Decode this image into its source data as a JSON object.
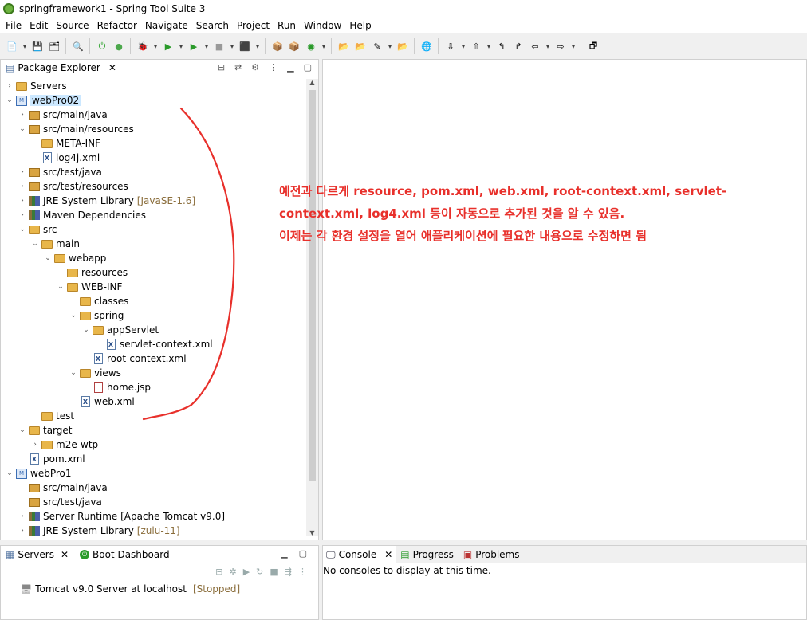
{
  "window": {
    "title": "springframework1 - Spring Tool Suite 3"
  },
  "menu": [
    "File",
    "Edit",
    "Source",
    "Refactor",
    "Navigate",
    "Search",
    "Project",
    "Run",
    "Window",
    "Help"
  ],
  "package_explorer": {
    "tab": "Package Explorer",
    "items": [
      {
        "label": "Servers",
        "kind": "folder",
        "depth": 0,
        "twisty": "›"
      },
      {
        "label": "webPro02",
        "kind": "project",
        "depth": 0,
        "twisty": "⌄",
        "selected": true
      },
      {
        "label": "src/main/java",
        "kind": "pkg",
        "depth": 1,
        "twisty": "›"
      },
      {
        "label": "src/main/resources",
        "kind": "pkg",
        "depth": 1,
        "twisty": "⌄"
      },
      {
        "label": "META-INF",
        "kind": "folder",
        "depth": 2,
        "twisty": ""
      },
      {
        "label": "log4j.xml",
        "kind": "xml",
        "depth": 2,
        "twisty": ""
      },
      {
        "label": "src/test/java",
        "kind": "pkg",
        "depth": 1,
        "twisty": "›"
      },
      {
        "label": "src/test/resources",
        "kind": "pkg",
        "depth": 1,
        "twisty": "›"
      },
      {
        "label": "JRE System Library",
        "suffix": "[JavaSE-1.6]",
        "kind": "lib",
        "depth": 1,
        "twisty": "›"
      },
      {
        "label": "Maven Dependencies",
        "kind": "lib",
        "depth": 1,
        "twisty": "›"
      },
      {
        "label": "src",
        "kind": "folder",
        "depth": 1,
        "twisty": "⌄"
      },
      {
        "label": "main",
        "kind": "folder",
        "depth": 2,
        "twisty": "⌄"
      },
      {
        "label": "webapp",
        "kind": "folder",
        "depth": 3,
        "twisty": "⌄"
      },
      {
        "label": "resources",
        "kind": "folder",
        "depth": 4,
        "twisty": ""
      },
      {
        "label": "WEB-INF",
        "kind": "folder",
        "depth": 4,
        "twisty": "⌄"
      },
      {
        "label": "classes",
        "kind": "folder",
        "depth": 5,
        "twisty": ""
      },
      {
        "label": "spring",
        "kind": "folder",
        "depth": 5,
        "twisty": "⌄"
      },
      {
        "label": "appServlet",
        "kind": "folder",
        "depth": 6,
        "twisty": "⌄"
      },
      {
        "label": "servlet-context.xml",
        "kind": "xml",
        "depth": 7,
        "twisty": ""
      },
      {
        "label": "root-context.xml",
        "kind": "xml",
        "depth": 6,
        "twisty": ""
      },
      {
        "label": "views",
        "kind": "folder",
        "depth": 5,
        "twisty": "⌄"
      },
      {
        "label": "home.jsp",
        "kind": "jsp",
        "depth": 6,
        "twisty": ""
      },
      {
        "label": "web.xml",
        "kind": "xml",
        "depth": 5,
        "twisty": ""
      },
      {
        "label": "test",
        "kind": "folder",
        "depth": 2,
        "twisty": ""
      },
      {
        "label": "target",
        "kind": "folder",
        "depth": 1,
        "twisty": "⌄"
      },
      {
        "label": "m2e-wtp",
        "kind": "folder",
        "depth": 2,
        "twisty": "›"
      },
      {
        "label": "pom.xml",
        "kind": "xml",
        "depth": 1,
        "twisty": ""
      },
      {
        "label": "webPro1",
        "kind": "project",
        "depth": 0,
        "twisty": "⌄"
      },
      {
        "label": "src/main/java",
        "kind": "pkg",
        "depth": 1,
        "twisty": ""
      },
      {
        "label": "src/test/java",
        "kind": "pkg",
        "depth": 1,
        "twisty": ""
      },
      {
        "label": "Server Runtime [Apache Tomcat v9.0]",
        "kind": "lib",
        "depth": 1,
        "twisty": "›"
      },
      {
        "label": "JRE System Library",
        "suffix": "[zulu-11]",
        "kind": "lib",
        "depth": 1,
        "twisty": "›"
      }
    ]
  },
  "annotation": {
    "line1": "예전과 다르게 resource, pom.xml, web.xml, root-context.xml, servlet-",
    "line2": "context.xml, log4.xml 등이 자동으로 추가된 것을 알 수 있음.",
    "line3": "이제는 각 환경 설정을 열어 애플리케이션에 필요한 내용으로 수정하면 됨",
    "color": "#e8302b"
  },
  "servers_panel": {
    "tab1": "Servers",
    "tab2": "Boot Dashboard",
    "server_name": "Tomcat v9.0 Server at localhost",
    "server_state": "[Stopped]"
  },
  "console_panel": {
    "tab1": "Console",
    "tab2": "Progress",
    "tab3": "Problems",
    "message": "No consoles to display at this time."
  }
}
